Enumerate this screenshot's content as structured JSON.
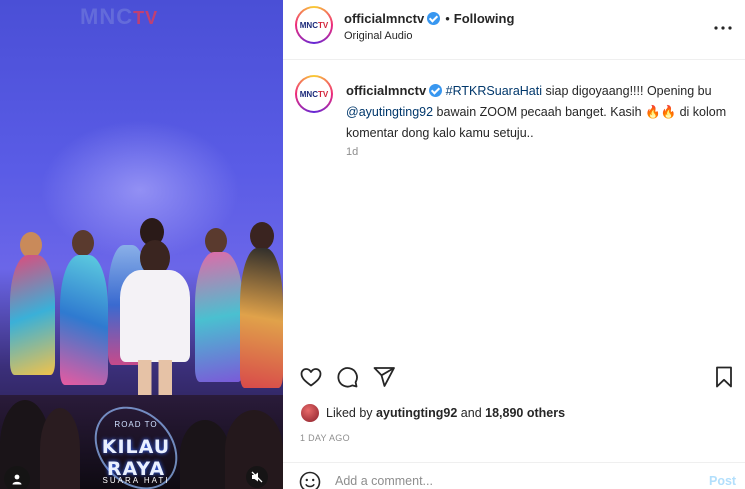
{
  "media": {
    "watermark_main": "MNC",
    "watermark_tv": "TV",
    "overlay_logo": {
      "top_text": "ROAD TO",
      "main_text": "KILAU RAYA",
      "bottom_text": "SUARA HATI"
    },
    "icons": [
      "user-tag-icon",
      "mute-icon"
    ]
  },
  "header": {
    "avatar_text": "MNC",
    "avatar_text_accent": "TV",
    "username": "officialmnctv",
    "separator": "•",
    "follow_status": "Following",
    "audio": "Original Audio"
  },
  "caption": {
    "username": "officialmnctv",
    "hashtag": "#RTKRSuaraHati",
    "text_1": " siap digoyaang!!!! Opening bu ",
    "mention": "@ayutingting92",
    "text_2": " bawain ZOOM pecaah banget. Kasih 🔥🔥 di kolom komentar dong kalo kamu setuju..",
    "time": "1d"
  },
  "likes": {
    "prefix": "Liked by ",
    "user": "ayutingting92",
    "middle": " and ",
    "others": "18,890 others"
  },
  "post_date": "1 DAY AGO",
  "comment": {
    "placeholder": "Add a comment...",
    "post_label": "Post"
  },
  "colors": {
    "verified": "#3897f0",
    "link": "#00376b",
    "muted": "#8e8e8e",
    "post_disabled": "#b2dffc"
  }
}
